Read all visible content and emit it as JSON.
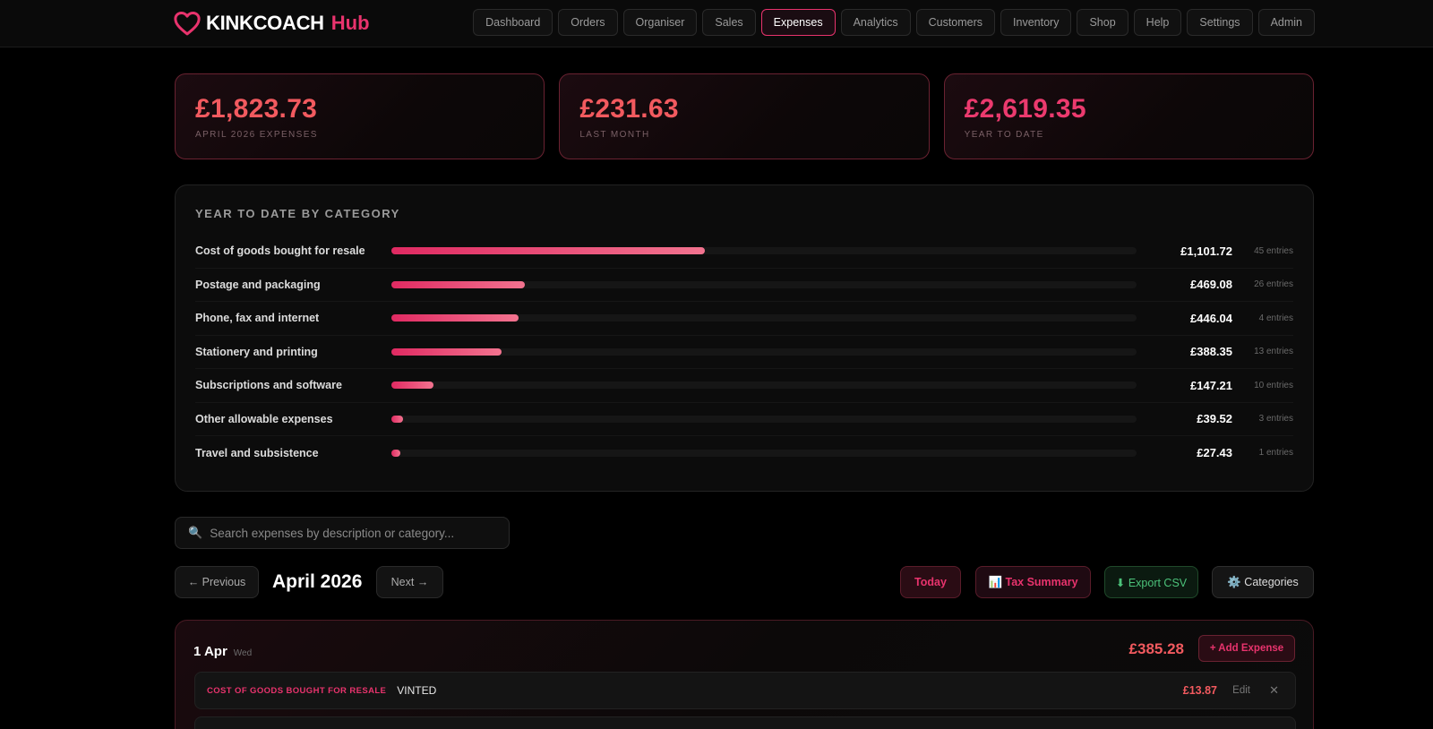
{
  "brand": {
    "name": "KINKCOACH",
    "suffix": "Hub",
    "icon": "heart-icon",
    "accent": "#e8336d"
  },
  "nav": {
    "items": [
      {
        "label": "Dashboard",
        "active": false
      },
      {
        "label": "Orders",
        "active": false
      },
      {
        "label": "Organiser",
        "active": false
      },
      {
        "label": "Sales",
        "active": false
      },
      {
        "label": "Expenses",
        "active": true
      },
      {
        "label": "Analytics",
        "active": false
      },
      {
        "label": "Customers",
        "active": false
      },
      {
        "label": "Inventory",
        "active": false
      },
      {
        "label": "Shop",
        "active": false
      },
      {
        "label": "Help",
        "active": false
      },
      {
        "label": "Settings",
        "active": false
      },
      {
        "label": "Admin",
        "active": false
      }
    ]
  },
  "stats": [
    {
      "value": "£1,823.73",
      "label": "April 2026 Expenses"
    },
    {
      "value": "£231.63",
      "label": "Last Month"
    },
    {
      "value": "£2,619.35",
      "label": "Year to Date"
    }
  ],
  "categories": {
    "title": "YEAR TO DATE BY CATEGORY",
    "max_amount": 2619.35,
    "rows": [
      {
        "name": "Cost of goods bought for resale",
        "amount": "£1,101.72",
        "value": 1101.72,
        "count": "45 entries"
      },
      {
        "name": "Postage and packaging",
        "amount": "£469.08",
        "value": 469.08,
        "count": "26 entries"
      },
      {
        "name": "Phone, fax and internet",
        "amount": "£446.04",
        "value": 446.04,
        "count": "4 entries"
      },
      {
        "name": "Stationery and printing",
        "amount": "£388.35",
        "value": 388.35,
        "count": "13 entries"
      },
      {
        "name": "Subscriptions and software",
        "amount": "£147.21",
        "value": 147.21,
        "count": "10 entries"
      },
      {
        "name": "Other allowable expenses",
        "amount": "£39.52",
        "value": 39.52,
        "count": "3 entries"
      },
      {
        "name": "Travel and subsistence",
        "amount": "£27.43",
        "value": 27.43,
        "count": "1 entries"
      }
    ]
  },
  "search": {
    "placeholder": "Search expenses by description or category...",
    "icon": "search-icon"
  },
  "month_bar": {
    "prev_label": "← Previous",
    "month": "April 2026",
    "next_label": "Next →",
    "today_label": "Today",
    "tax_label": "📊 Tax Summary",
    "csv_label": "⬇ Export CSV",
    "categories_label": "⚙️ Categories"
  },
  "day": {
    "date": "1 Apr",
    "weekday": "Wed",
    "total": "£385.28",
    "add_label": "+ Add Expense",
    "expenses": [
      {
        "category": "Cost of goods bought for resale",
        "description": "VINTED",
        "amount": "£13.87",
        "edit_label": "Edit",
        "delete_label": "✕"
      }
    ]
  }
}
